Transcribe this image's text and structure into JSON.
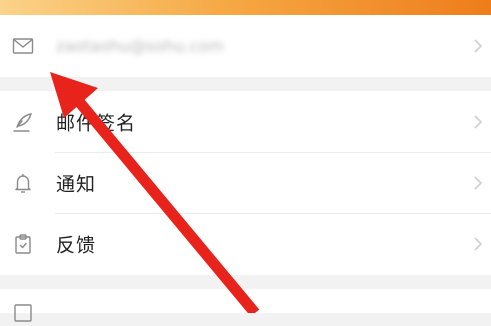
{
  "account": {
    "email": "zaotaohu@sohu.com",
    "icon": "mail-icon"
  },
  "settings": {
    "items": [
      {
        "label": "邮件签名",
        "icon": "signature-pen-icon"
      },
      {
        "label": "通知",
        "icon": "bell-icon"
      },
      {
        "label": "反馈",
        "icon": "clipboard-icon"
      }
    ]
  },
  "colors": {
    "top_bar_gradient": [
      "#fbd38a",
      "#f6a945",
      "#ee7d1a"
    ],
    "arrow": "#e8231b",
    "chevron": "#cfcfcf"
  }
}
